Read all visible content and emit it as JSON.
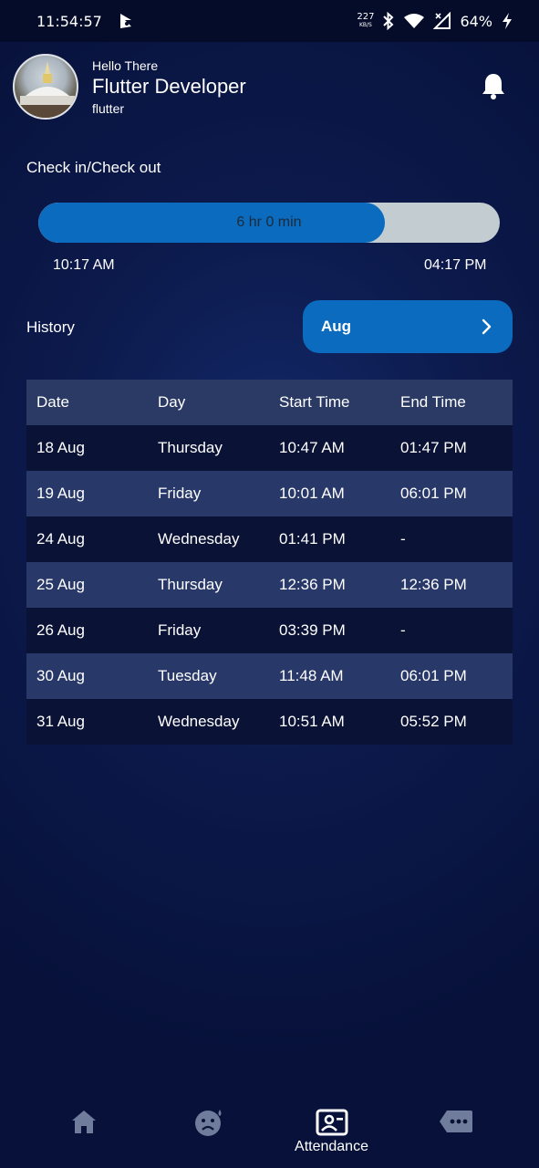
{
  "status_bar": {
    "time": "11:54:57",
    "net_speed_value": "227",
    "net_speed_unit": "KB/S",
    "battery": "64%"
  },
  "header": {
    "greeting": "Hello There",
    "name": "Flutter Developer",
    "subtitle": "flutter"
  },
  "checkin": {
    "title": "Check in/Check out",
    "duration": "6 hr 0 min",
    "progress_fraction": 0.75,
    "start_time": "10:17 AM",
    "end_time": "04:17 PM"
  },
  "history": {
    "title": "History",
    "month": "Aug"
  },
  "table": {
    "headers": [
      "Date",
      "Day",
      "Start Time",
      "End Time"
    ],
    "rows": [
      [
        "18 Aug",
        "Thursday",
        "10:47 AM",
        "01:47 PM"
      ],
      [
        "19 Aug",
        "Friday",
        "10:01 AM",
        "06:01 PM"
      ],
      [
        "24 Aug",
        "Wednesday",
        "01:41 PM",
        "-"
      ],
      [
        "25 Aug",
        "Thursday",
        "12:36 PM",
        "12:36 PM"
      ],
      [
        "26 Aug",
        "Friday",
        "03:39 PM",
        "-"
      ],
      [
        "30 Aug",
        "Tuesday",
        "11:48 AM",
        "06:01 PM"
      ],
      [
        "31 Aug",
        "Wednesday",
        "10:51 AM",
        "05:52 PM"
      ]
    ]
  },
  "bottom_nav": {
    "items": [
      {
        "icon": "home-icon"
      },
      {
        "icon": "sad-face-icon"
      },
      {
        "icon": "attendance-icon",
        "label": "Attendance"
      },
      {
        "icon": "chat-icon"
      }
    ]
  },
  "colors": {
    "accent": "#0a6bbf",
    "track": "#c3ccd1",
    "inactive_icon": "#6f7c9b"
  }
}
